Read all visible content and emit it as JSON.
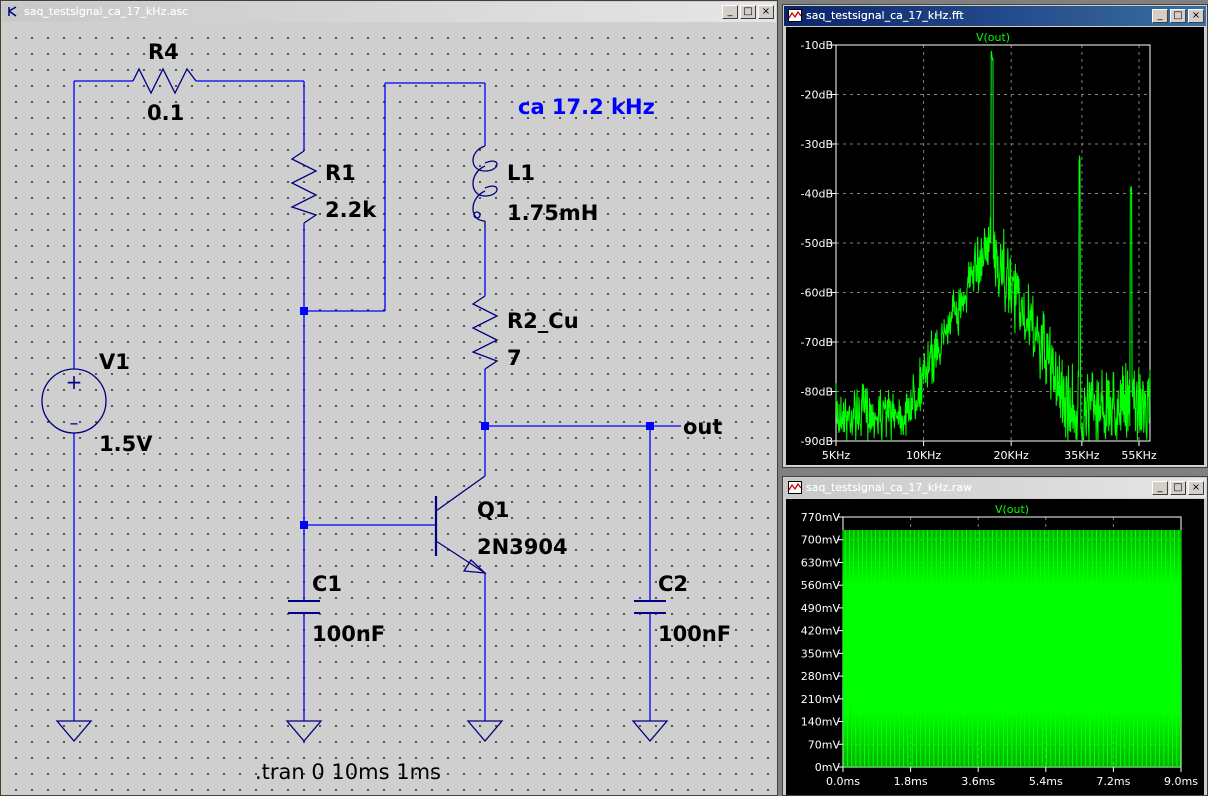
{
  "windows": {
    "schematic": {
      "title": "saq_testsignal_ca_17_kHz.asc",
      "buttons": [
        "_",
        "□",
        "×"
      ]
    },
    "fft": {
      "title": "saq_testsignal_ca_17_kHz.fft",
      "buttons": [
        "_",
        "□",
        "×"
      ]
    },
    "raw": {
      "title": "saq_testsignal_ca_17_kHz.raw",
      "buttons": [
        "_",
        "□",
        "×"
      ]
    }
  },
  "schematic": {
    "components": {
      "R4": {
        "name": "R4",
        "value": "0.1"
      },
      "R1": {
        "name": "R1",
        "value": "2.2k"
      },
      "L1": {
        "name": "L1",
        "value": "1.75mH"
      },
      "R2": {
        "name": "R2_Cu",
        "value": "7"
      },
      "V1": {
        "name": "V1",
        "value": "1.5V"
      },
      "Q1": {
        "name": "Q1",
        "value": "2N3904"
      },
      "C1": {
        "name": "C1",
        "value": "100nF"
      },
      "C2": {
        "name": "C2",
        "value": "100nF"
      }
    },
    "net_label_out": "out",
    "annotation": "ca 17.2 kHz",
    "directive": ".tran 0 10ms 1ms",
    "source_plus": "+",
    "source_minus": "–"
  },
  "colors": {
    "wire": "#0000ff",
    "component": "#000080",
    "annotation": "#0000ff",
    "trace": "#00ff00",
    "plot_bg": "#000000",
    "grid": "#808080"
  },
  "chart_data": [
    {
      "type": "line",
      "window": "fft",
      "title": "V(out)",
      "x_scale": "log",
      "xlim": [
        5000,
        60000
      ],
      "ylim": [
        -90,
        -10
      ],
      "x_tick_labels": [
        "5KHz",
        "10KHz",
        "20KHz",
        "35KHz",
        "55KHz"
      ],
      "x_tick_values": [
        5000,
        10000,
        20000,
        35000,
        55000
      ],
      "y_tick_labels": [
        "-10dB",
        "-20dB",
        "-30dB",
        "-40dB",
        "-50dB",
        "-60dB",
        "-70dB",
        "-80dB",
        "-90dB"
      ],
      "y_tick_values": [
        -10,
        -20,
        -30,
        -40,
        -50,
        -60,
        -70,
        -80,
        -90
      ],
      "peaks": [
        {
          "x": 17200,
          "y": -13
        },
        {
          "x": 34400,
          "y": -34
        },
        {
          "x": 51600,
          "y": -40
        }
      ],
      "noise_floor": -82,
      "grid": true
    },
    {
      "type": "line",
      "window": "raw",
      "title": "V(out)",
      "xlim": [
        0,
        9.0
      ],
      "ylim": [
        0,
        770
      ],
      "x_tick_labels": [
        "0.0ms",
        "1.8ms",
        "3.6ms",
        "5.4ms",
        "7.2ms",
        "9.0ms"
      ],
      "x_tick_values": [
        0,
        1.8,
        3.6,
        5.4,
        7.2,
        9.0
      ],
      "y_tick_labels": [
        "770mV",
        "700mV",
        "630mV",
        "560mV",
        "490mV",
        "420mV",
        "350mV",
        "280mV",
        "210mV",
        "140mV",
        "70mV",
        "0mV"
      ],
      "y_tick_values": [
        770,
        700,
        630,
        560,
        490,
        420,
        350,
        280,
        210,
        140,
        70,
        0
      ],
      "signal": {
        "frequency_khz": 17.2,
        "min_mv": 0,
        "max_mv": 730
      },
      "grid": true
    }
  ]
}
